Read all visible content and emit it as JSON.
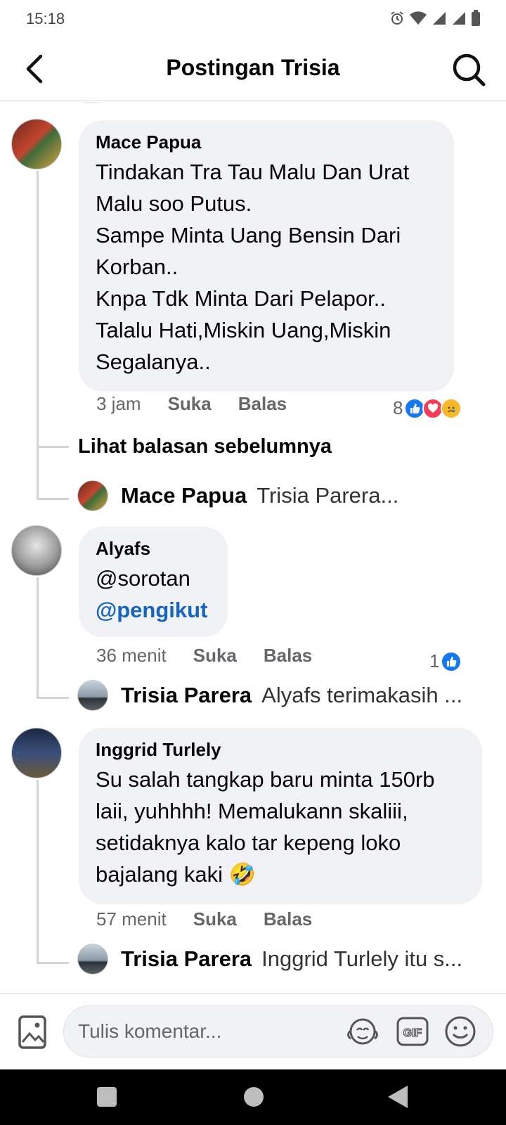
{
  "status": {
    "time": "15:18"
  },
  "header": {
    "title": "Postingan Trisia"
  },
  "comments": [
    {
      "author": "Mace Papua",
      "text": "Tindakan Tra Tau Malu Dan Urat\nMalu soo Putus.\nSampe Minta Uang Bensin Dari\nKorban..\nKnpa Tdk Minta Dari Pelapor..\nTalalu Hati,Miskin Uang,Miskin\nSegalanya..",
      "time": "3 jam",
      "like": "Suka",
      "reply": "Balas",
      "reaction_count": "8",
      "see_previous": "Lihat balasan sebelumnya",
      "reply_preview": {
        "author": "Mace Papua",
        "text": "Trisia Parera..."
      }
    },
    {
      "author": "Alyafs",
      "text_line1": "@sorotan",
      "mention": "@pengikut",
      "time": "36 menit",
      "like": "Suka",
      "reply": "Balas",
      "reaction_count": "1",
      "reply_preview": {
        "author": "Trisia Parera",
        "text": "Alyafs terimakasih ..."
      }
    },
    {
      "author": "Inggrid Turlely",
      "text": "Su salah tangkap baru minta 150rb\nlaii, yuhhhh! Memalukann skaliii,\nsetidaknya kalo tar kepeng loko\nbajalang kaki 🤣",
      "time": "57 menit",
      "like": "Suka",
      "reply": "Balas",
      "reply_preview": {
        "author": "Trisia Parera",
        "text": "Inggrid Turlely itu s..."
      }
    }
  ],
  "composer": {
    "placeholder": "Tulis komentar...",
    "gif_label": "GIF"
  },
  "colors": {
    "accent": "#1877f2",
    "bubble": "#f0f2f5",
    "muted": "#65676b",
    "love": "#f33e58",
    "mention": "#1565c0"
  }
}
